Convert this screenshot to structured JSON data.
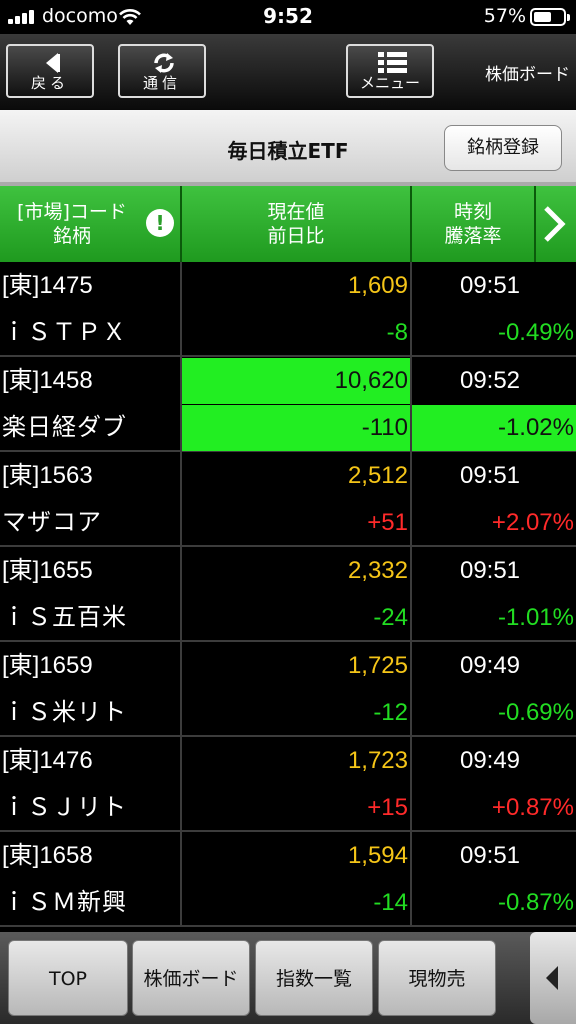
{
  "status": {
    "carrier": "docomo",
    "time": "9:52",
    "battery": "57%"
  },
  "toolbar": {
    "back_label": "戻る",
    "refresh_label": "通信",
    "menu_label": "メニュー",
    "screen_title": "株価ボード"
  },
  "titlebar": {
    "title": "毎日積立ETF",
    "register_label": "銘柄登録"
  },
  "header": {
    "col1_line1": "[市場]コード",
    "col1_line2": "銘柄",
    "col2_line1": "現在値",
    "col2_line2": "前日比",
    "col3_line1": "時刻",
    "col3_line2": "騰落率"
  },
  "colors": {
    "price": "#f5c518",
    "down": "#22dd22",
    "up": "#ff2a2a",
    "header_green": "#2fae2f"
  },
  "rows": [
    {
      "code": "[東]1475",
      "name": "ｉＳＴＰＸ",
      "price": "1,609",
      "change": "-8",
      "time": "09:51",
      "pct": "-0.49%",
      "dir": "down",
      "highlight": false
    },
    {
      "code": "[東]1458",
      "name": "楽日経ダブ",
      "price": "10,620",
      "change": "-110",
      "time": "09:52",
      "pct": "-1.02%",
      "dir": "down",
      "highlight": true
    },
    {
      "code": "[東]1563",
      "name": "マザコア",
      "price": "2,512",
      "change": "+51",
      "time": "09:51",
      "pct": "+2.07%",
      "dir": "up",
      "highlight": false
    },
    {
      "code": "[東]1655",
      "name": "ｉＳ五百米",
      "price": "2,332",
      "change": "-24",
      "time": "09:51",
      "pct": "-1.01%",
      "dir": "down",
      "highlight": false
    },
    {
      "code": "[東]1659",
      "name": "ｉＳ米リト",
      "price": "1,725",
      "change": "-12",
      "time": "09:49",
      "pct": "-0.69%",
      "dir": "down",
      "highlight": false
    },
    {
      "code": "[東]1476",
      "name": "ｉＳＪリト",
      "price": "1,723",
      "change": "+15",
      "time": "09:49",
      "pct": "+0.87%",
      "dir": "up",
      "highlight": false
    },
    {
      "code": "[東]1658",
      "name": "ｉＳＭ新興",
      "price": "1,594",
      "change": "-14",
      "time": "09:51",
      "pct": "-0.87%",
      "dir": "down",
      "highlight": false
    }
  ],
  "tabs": {
    "top": "TOP",
    "board": "株価ボード",
    "index": "指数一覧",
    "spot_sell": "現物売"
  }
}
